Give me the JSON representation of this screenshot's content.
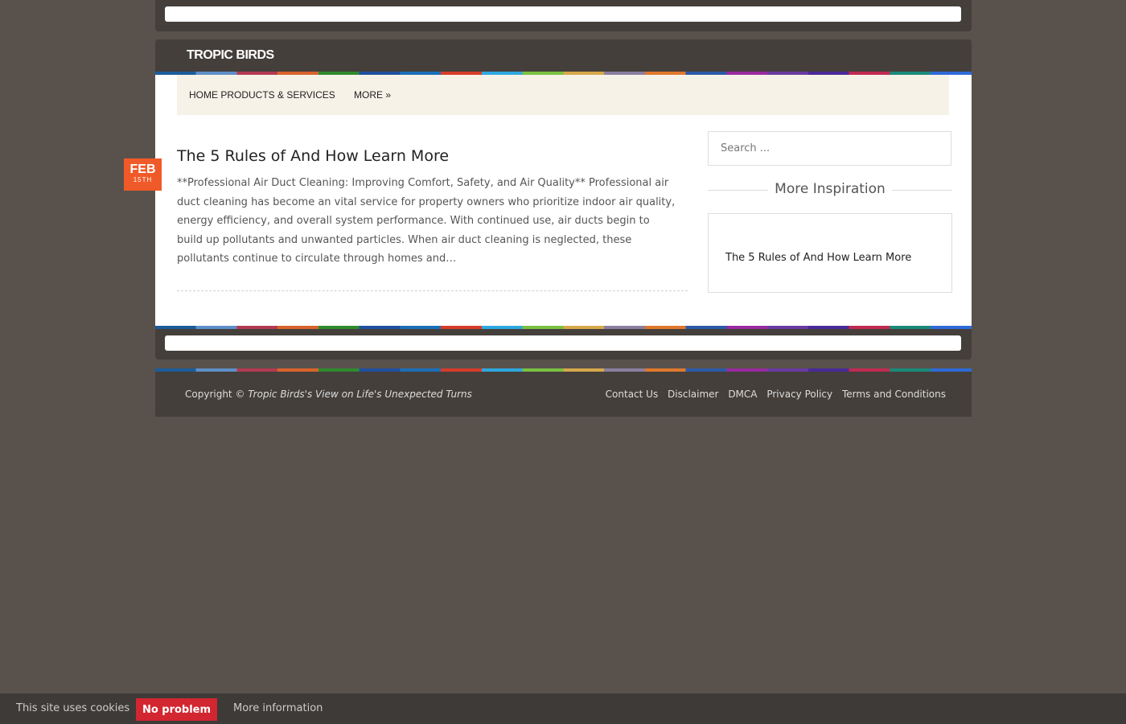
{
  "header": {
    "site_title": "TROPIC BIRDS"
  },
  "nav": {
    "items": [
      {
        "label": "HOME PRODUCTS & SERVICES"
      },
      {
        "label": "MORE »"
      }
    ]
  },
  "post": {
    "date_month": "FEB",
    "date_day": "15TH",
    "title": "The 5 Rules of And How Learn More",
    "excerpt": "**Professional Air Duct Cleaning: Improving Comfort, Safety, and Air Quality** Professional air duct cleaning has become an vital service for property owners who prioritize indoor air quality, energy efficiency, and overall system performance. With continued use, air ducts begin to build up pollutants and unwanted particles. When air duct cleaning is neglected, these pollutants continue to circulate through homes and…"
  },
  "sidebar": {
    "search_placeholder": "Search ...",
    "widget_title": "More Inspiration",
    "widget_link": "The 5 Rules of And How Learn More"
  },
  "footer": {
    "copyright_prefix": "Copyright ©",
    "copyright_site": "Tropic Birds's View on Life's Unexpected Turns",
    "links": [
      {
        "label": "Contact Us"
      },
      {
        "label": "Disclaimer"
      },
      {
        "label": "DMCA"
      },
      {
        "label": "Privacy Policy"
      },
      {
        "label": "Terms and Conditions"
      }
    ]
  },
  "cookie": {
    "text": "This site uses cookies",
    "button": "No problem",
    "more": "More information"
  },
  "colors": {
    "accent": "#f05a28",
    "cookie_button": "#d22630",
    "frame": "#443f3b"
  }
}
